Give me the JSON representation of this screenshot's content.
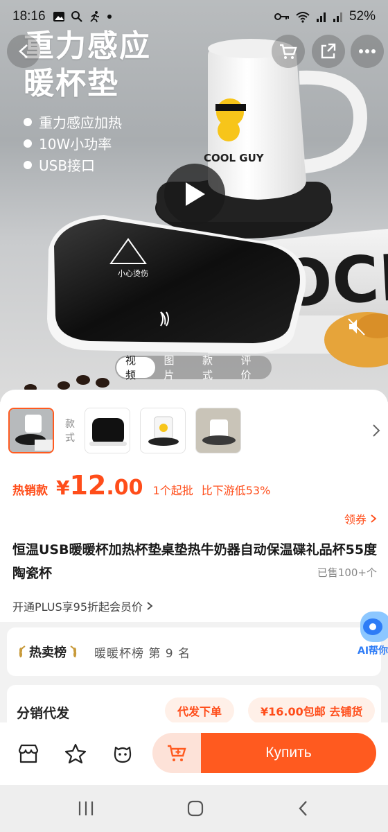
{
  "status_bar": {
    "time": "18:16",
    "battery": "52%"
  },
  "hero": {
    "title_line1": "重力感应",
    "title_line2": "暖杯垫",
    "features": [
      "重力感应加热",
      "10W小功率",
      "USB接口"
    ],
    "mug_text": "COOL GUY",
    "book_text": "ROCK",
    "warning_text": "小心烫伤",
    "media_tabs": [
      "视频",
      "图片",
      "款式",
      "评价"
    ],
    "active_tab": 0
  },
  "product": {
    "style_label": "款式",
    "hot_tag": "热销款",
    "currency": "¥",
    "price_int": "12",
    "price_dec": ".00",
    "moq": "1个起批",
    "compare": "比下游低53%",
    "coupon": "领券",
    "title": "恒温USB暖暖杯加热杯垫桌垫热牛奶器自动保温碟礼品杯55度陶瓷杯",
    "sold": "已售100+个",
    "plus": "开通PLUS享95折起会员价"
  },
  "rank": {
    "badge": "热卖榜",
    "text": "暖暖杯榜  第 9 名"
  },
  "ai": {
    "label": "AI帮你"
  },
  "distribution": {
    "title": "分销代发",
    "order_label": "代发下单",
    "stock_label": "¥16.00包邮 去铺货"
  },
  "action_bar": {
    "buy_label": "Купить"
  },
  "colors": {
    "accent": "#ff5a1f",
    "accent_text": "#ff4d1a",
    "ai_blue": "#2e7cf6"
  }
}
